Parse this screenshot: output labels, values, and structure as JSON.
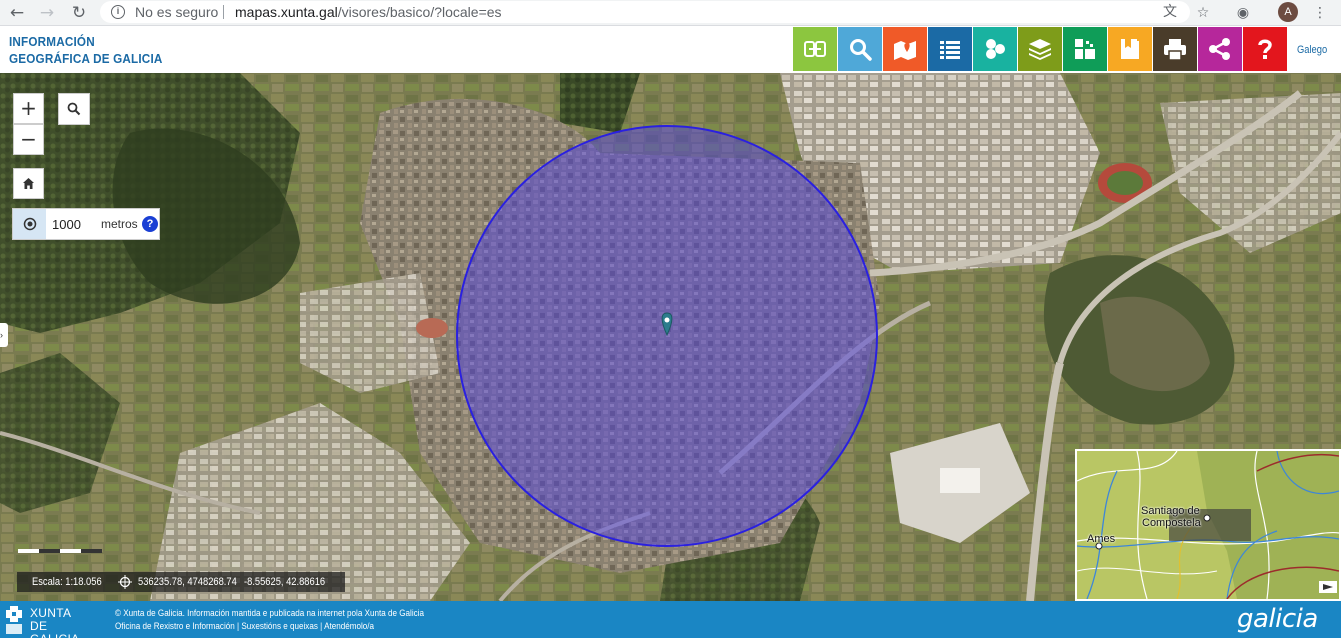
{
  "browser": {
    "security_label": "No es seguro",
    "url_host": "mapas.xunta.gal",
    "url_path": "/visores/basico/?locale=es",
    "profile_initial": "A"
  },
  "header": {
    "brand_line1": "INFORMACIÓN",
    "brand_line2": "GEOGRÁFICA DE GALICIA",
    "language_link": "Galego",
    "toolbar": [
      {
        "name": "coordinates-tool",
        "icon": "coordinates-icon",
        "color": "#8cc63f"
      },
      {
        "name": "search-tool",
        "icon": "search-icon",
        "color": "#4fa8d8"
      },
      {
        "name": "place-search-tool",
        "icon": "map-marker-icon",
        "color": "#f05a28"
      },
      {
        "name": "legend-tool",
        "icon": "list-icon",
        "color": "#1b6aa5"
      },
      {
        "name": "layers-catalog-tool",
        "icon": "circles-icon",
        "color": "#19b2a0"
      },
      {
        "name": "layers-tool",
        "icon": "layers-icon",
        "color": "#7e9c1a"
      },
      {
        "name": "basemap-tool",
        "icon": "basemap-icon",
        "color": "#0f9d58"
      },
      {
        "name": "bookmarks-tool",
        "icon": "book-icon",
        "color": "#f7a823"
      },
      {
        "name": "print-tool",
        "icon": "print-icon",
        "color": "#4a3c2a"
      },
      {
        "name": "share-tool",
        "icon": "share-icon",
        "color": "#b6279b"
      },
      {
        "name": "help-tool",
        "icon": "question-icon",
        "color": "#e3161d"
      }
    ]
  },
  "map": {
    "zoom_in": "+",
    "zoom_out": "−",
    "radius_value": "1000",
    "radius_unit": "metros",
    "help": "?",
    "scale_label": "Escala: 1:18.056",
    "coordinates_utm": "536235.78, 4748268.74",
    "coordinates_geo": "-8.55625, 42.88616",
    "buffer_color": "#4b3cf0",
    "overview": {
      "label_city": "Santiago de Compostela",
      "label_city_line1": "Santiago de",
      "label_city_line2": "Compostela",
      "label_town": "Ames"
    }
  },
  "footer": {
    "org_line1": "XUNTA",
    "org_line2": "DE GALICIA",
    "copyright": "© Xunta de Galicia. Información mantida e publicada na internet pola Xunta de Galicia",
    "link_office": "Oficina de Rexistro e Información",
    "link_suggestions": "Suxestións e queixas",
    "link_attention": "Atendémolo/a",
    "brand": "galicia"
  }
}
